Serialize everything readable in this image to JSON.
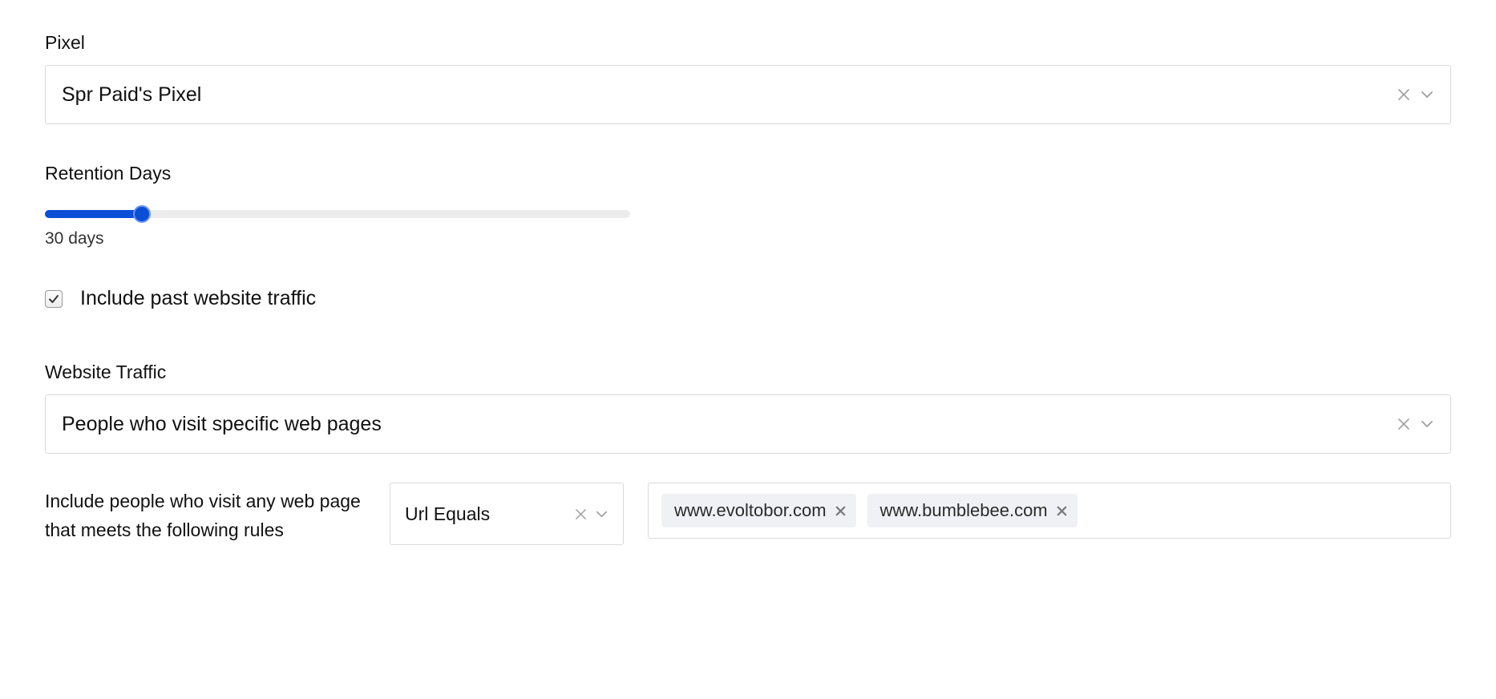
{
  "pixel": {
    "label": "Pixel",
    "value": "Spr Paid's Pixel"
  },
  "retention": {
    "label": "Retention Days",
    "caption": "30 days",
    "value": 30,
    "min": 0,
    "max": 180
  },
  "include_past": {
    "checked": true,
    "label": "Include past website traffic"
  },
  "website_traffic": {
    "label": "Website Traffic",
    "value": "People who visit specific web pages"
  },
  "rule": {
    "description": "Include people who visit any web page that meets the following rules",
    "condition": "Url Equals",
    "tags": [
      "www.evoltobor.com",
      "www.bumblebee.com"
    ]
  }
}
